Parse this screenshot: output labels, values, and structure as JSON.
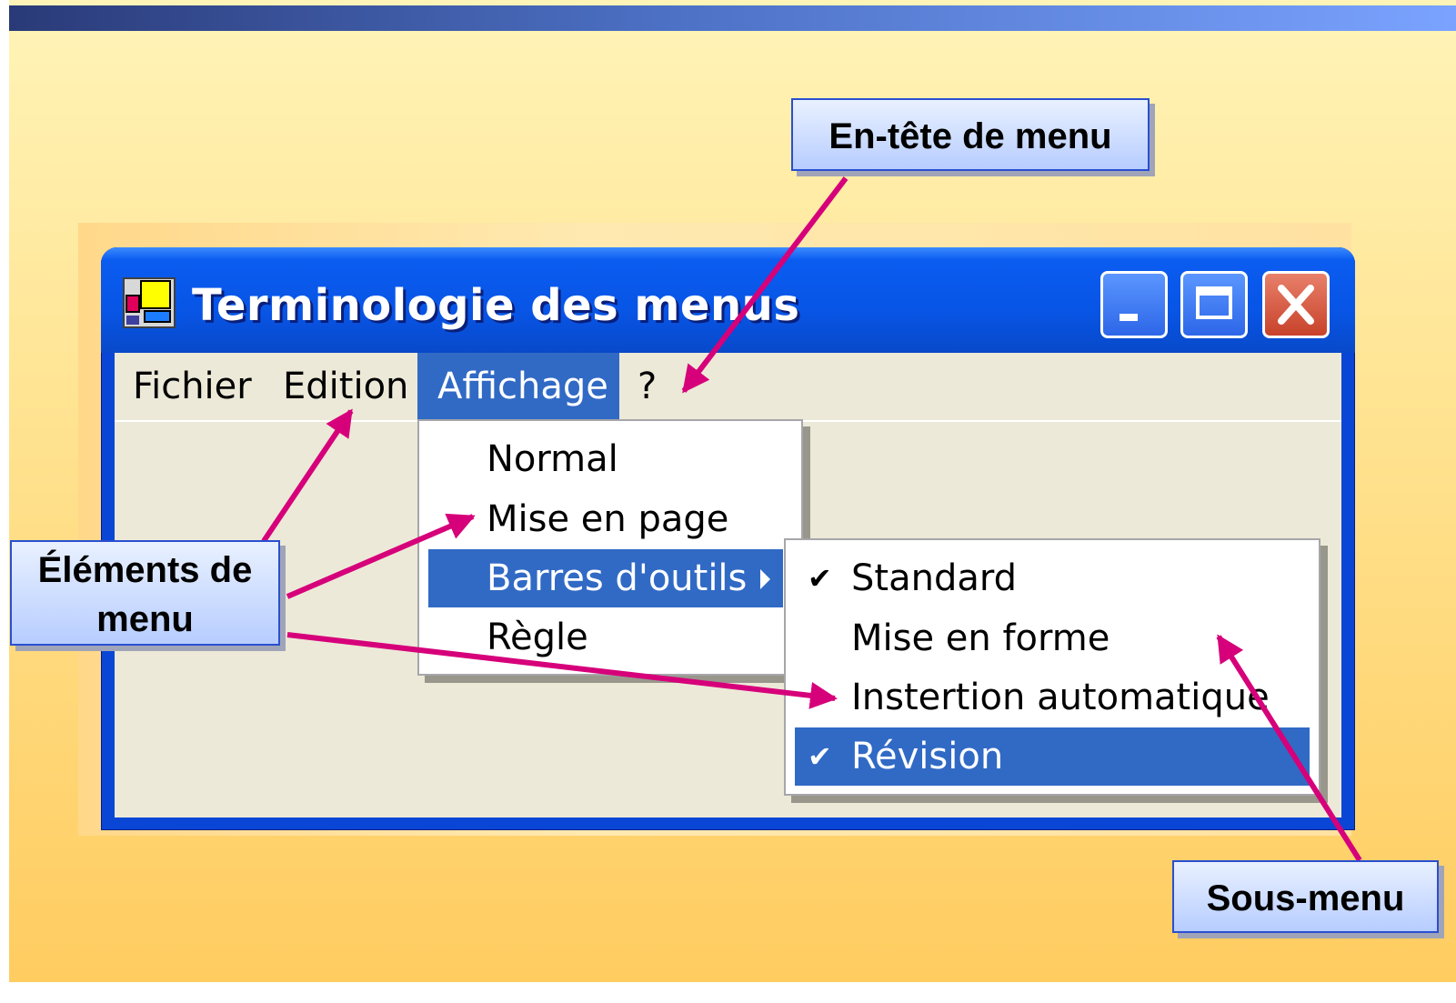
{
  "window": {
    "title": "Terminologie des menus",
    "controls": [
      "minimize",
      "maximize",
      "close"
    ]
  },
  "menubar": {
    "items": [
      {
        "label": "Fichier"
      },
      {
        "label": "Edition"
      },
      {
        "label": "Affichage",
        "selected": true
      },
      {
        "label": "?"
      }
    ]
  },
  "dropdown": {
    "items": [
      {
        "label": "Normal"
      },
      {
        "label": "Mise en page"
      },
      {
        "label": "Barres d'outils",
        "selected": true,
        "has_submenu": true
      },
      {
        "label": "Règle"
      }
    ]
  },
  "submenu": {
    "items": [
      {
        "label": "Standard",
        "checked": true
      },
      {
        "label": "Mise en forme",
        "checked": false
      },
      {
        "label": "Instertion automatique",
        "checked": false
      },
      {
        "label": "Révision",
        "checked": true,
        "selected": true
      }
    ],
    "check_glyph": "✔"
  },
  "callouts": {
    "menu_header": "En-tête de menu",
    "menu_items_line1": "Éléments de",
    "menu_items_line2": "menu",
    "submenu": "Sous-menu"
  },
  "colors": {
    "arrow": "#d6007a",
    "selection": "#316ac5",
    "titlebar": "#0855e6"
  },
  "icons": {
    "app": "app-window-icon",
    "minimize": "minimize-icon",
    "maximize": "maximize-icon",
    "close": "close-icon",
    "submenu_arrow": "chevron-right-icon",
    "check": "checkmark-icon"
  }
}
